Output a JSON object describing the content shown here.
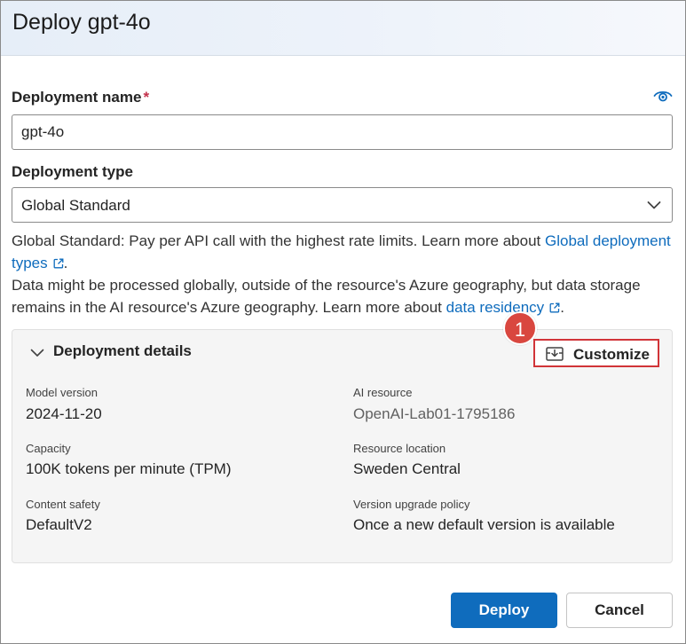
{
  "dialog": {
    "title": "Deploy gpt-4o"
  },
  "deployment_name": {
    "label": "Deployment name",
    "required_mark": "*",
    "value": "gpt-4o"
  },
  "deployment_type": {
    "label": "Deployment type",
    "selected": "Global Standard",
    "description_line1": "Global Standard: Pay per API call with the highest rate limits. Learn more about ",
    "link1": "Global deployment types",
    "description_line2": "Data might be processed globally, outside of the resource's Azure geography, but data storage remains in the AI resource's Azure geography. Learn more about ",
    "link2": "data residency"
  },
  "details": {
    "title": "Deployment details",
    "customize_label": "Customize",
    "annotation_badge": "1",
    "fields": {
      "model_version": {
        "label": "Model version",
        "value": "2024-11-20"
      },
      "ai_resource": {
        "label": "AI resource",
        "value": "OpenAI-Lab01-1795186"
      },
      "capacity": {
        "label": "Capacity",
        "value": "100K tokens per minute (TPM)"
      },
      "resource_location": {
        "label": "Resource location",
        "value": "Sweden Central"
      },
      "content_safety": {
        "label": "Content safety",
        "value": "DefaultV2"
      },
      "version_upgrade_policy": {
        "label": "Version upgrade policy",
        "value": "Once a new default version is available"
      }
    }
  },
  "footer": {
    "deploy_label": "Deploy",
    "cancel_label": "Cancel"
  },
  "colors": {
    "accent": "#0f6cbd",
    "required": "#c4314b",
    "highlight_border": "#d13438",
    "badge": "#d9473f"
  },
  "icons": {
    "eye": "eye-icon",
    "chevron": "chevron-down-icon",
    "external": "external-link-icon",
    "customize": "customize-icon"
  }
}
